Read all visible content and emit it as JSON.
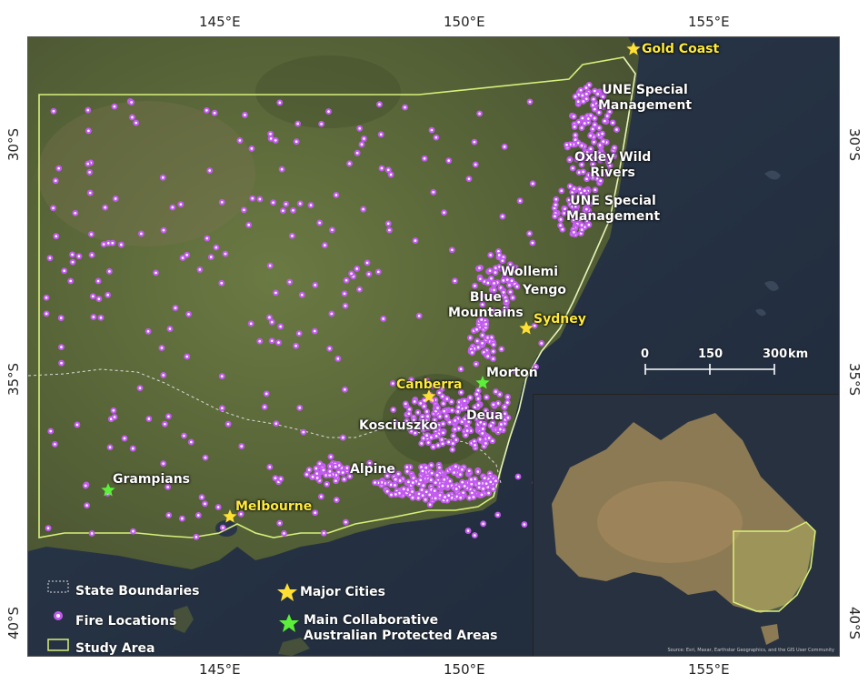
{
  "axes": {
    "top": [
      "145°E",
      "150°E",
      "155°E"
    ],
    "bottom": [
      "145°E",
      "150°E",
      "155°E"
    ],
    "left": [
      "30°S",
      "35°S",
      "40°S"
    ],
    "right": [
      "30°S",
      "35°S",
      "40°S"
    ]
  },
  "places": {
    "gold_coast": "Gold Coast",
    "une_1": "UNE Special\nManagement",
    "oxley": "Oxley Wild\nRivers",
    "une_2": "UNE Special\nManagement",
    "wollemi": "Wollemi",
    "yengo": "Yengo",
    "blue_mountains": "Blue\nMountains",
    "sydney": "Sydney",
    "morton": "Morton",
    "canberra": "Canberra",
    "deua": "Deua",
    "kosciuszko": "Kosciuszko",
    "alpine": "Alpine",
    "grampians": "Grampians",
    "melbourne": "Melbourne"
  },
  "scale_bar": {
    "t0": "0",
    "t1": "150",
    "t2": "300",
    "unit": "km"
  },
  "legend": {
    "state_boundaries": "State Boundaries",
    "fire_locations": "Fire Locations",
    "study_area": "Study Area",
    "major_cities": "Major Cities",
    "protected_areas": "Main Collaborative\nAustralian Protected Areas"
  },
  "inset_credit": "Source: Esri, Maxar, Earthstar Geographics, and the GIS User Community",
  "colors": {
    "fire": "#c45bf0",
    "fire_core": "#ffffff",
    "study_area": "#d8f07a",
    "city_star": "#ffe033",
    "protected_star": "#5cf03a",
    "ocean": "#2a3648",
    "land": "#5c6b3a"
  }
}
